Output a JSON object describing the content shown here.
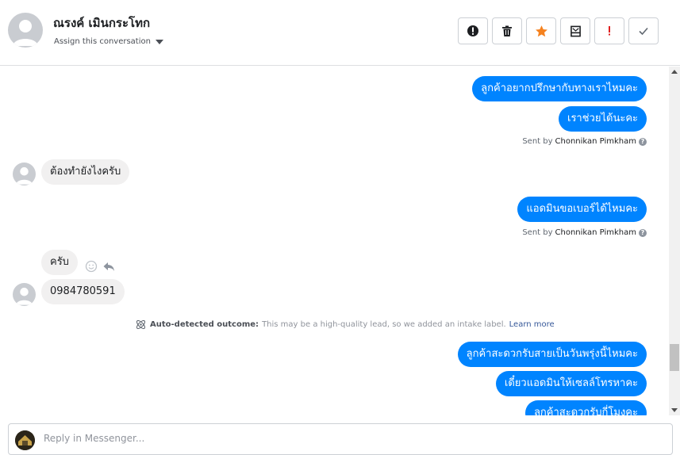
{
  "header": {
    "contact_name": "ณรงค์ เมินกระโทก",
    "assign_label": "Assign this conversation",
    "actions": [
      {
        "icon": "alert-circle-icon",
        "color": "#1c1e21"
      },
      {
        "icon": "trash-icon",
        "color": "#1c1e21"
      },
      {
        "icon": "star-icon",
        "color": "#f5821f"
      },
      {
        "icon": "archive-inbox-icon",
        "color": "#1c1e21"
      },
      {
        "icon": "exclamation-icon",
        "color": "#e02020"
      },
      {
        "icon": "checkmark-icon",
        "color": "#606770"
      }
    ]
  },
  "messages": {
    "m1": "ลูกค้าอยากปรึกษากับทางเราไหมคะ",
    "m2": "เราช่วยได้นะคะ",
    "sent1_prefix": "Sent by",
    "sent1_name": "Chonnikan Pimkham",
    "m3": "ต้องทำยังไงครับ",
    "m4": "แอดมินขอเบอร์ได้ไหมคะ",
    "sent2_prefix": "Sent by",
    "sent2_name": "Chonnikan Pimkham",
    "m5": "ครับ",
    "m6": "0984780591",
    "outcome_label": "Auto-detected outcome:",
    "outcome_text": "This may be a high-quality lead, so we added an intake label.",
    "outcome_link": "Learn more",
    "m7": "ลูกค้าสะดวกรับสายเป็นวันพรุ่งนี้ไหมคะ",
    "m8": "เดี๋ยวแอดมินให้เซลล์โทรหาคะ",
    "m9": "ลูกค้าสะดวกรับกี่โมงคะ"
  },
  "composer": {
    "placeholder": "Reply in Messenger..."
  },
  "colors": {
    "outgoing_bubble": "#0084ff",
    "incoming_bubble": "#f1f0f0",
    "link": "#365899"
  }
}
